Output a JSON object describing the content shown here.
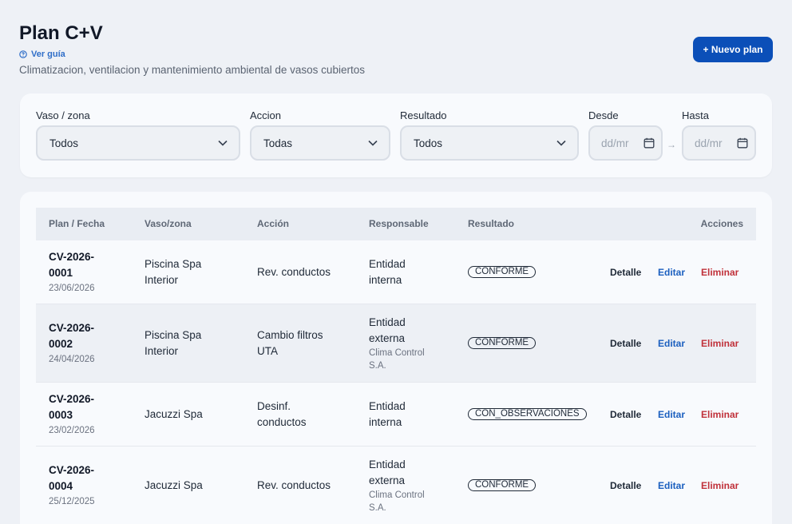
{
  "header": {
    "title": "Plan C+V",
    "guide_label": "Ver guía",
    "subtitle": "Climatizacion, ventilacion y mantenimiento ambiental de vasos cubiertos",
    "new_button": "+ Nuevo plan"
  },
  "filters": {
    "zone": {
      "label": "Vaso / zona",
      "value": "Todos"
    },
    "action": {
      "label": "Accion",
      "value": "Todas"
    },
    "result": {
      "label": "Resultado",
      "value": "Todos"
    },
    "from": {
      "label": "Desde",
      "placeholder": "dd/mr"
    },
    "to": {
      "label": "Hasta",
      "placeholder": "dd/mr"
    },
    "range_separator": "→"
  },
  "table": {
    "columns": [
      "Plan / Fecha",
      "Vaso/zona",
      "Acción",
      "Responsable",
      "Resultado",
      "Acciones"
    ],
    "action_labels": {
      "detail": "Detalle",
      "edit": "Editar",
      "delete": "Eliminar"
    },
    "rows": [
      {
        "code_a": "CV-2026-",
        "code_b": "0001",
        "date": "23/06/2026",
        "zone_a": "Piscina Spa",
        "zone_b": "Interior",
        "action_a": "Rev. conductos",
        "action_b": "",
        "resp_a": "Entidad",
        "resp_b": "interna",
        "resp_sub_a": "",
        "resp_sub_b": "",
        "result": "CONFORME"
      },
      {
        "code_a": "CV-2026-",
        "code_b": "0002",
        "date": "24/04/2026",
        "zone_a": "Piscina Spa",
        "zone_b": "Interior",
        "action_a": "Cambio filtros",
        "action_b": "UTA",
        "resp_a": "Entidad",
        "resp_b": "externa",
        "resp_sub_a": "Clima Control",
        "resp_sub_b": "S.A.",
        "result": "CONFORME"
      },
      {
        "code_a": "CV-2026-",
        "code_b": "0003",
        "date": "23/02/2026",
        "zone_a": "Jacuzzi Spa",
        "zone_b": "",
        "action_a": "Desinf.",
        "action_b": "conductos",
        "resp_a": "Entidad",
        "resp_b": "interna",
        "resp_sub_a": "",
        "resp_sub_b": "",
        "result": "CON_OBSERVACIONES"
      },
      {
        "code_a": "CV-2026-",
        "code_b": "0004",
        "date": "25/12/2025",
        "zone_a": "Jacuzzi Spa",
        "zone_b": "",
        "action_a": "Rev. conductos",
        "action_b": "",
        "resp_a": "Entidad",
        "resp_b": "externa",
        "resp_sub_a": "Clima Control",
        "resp_sub_b": "S.A.",
        "result": "CONFORME"
      }
    ]
  },
  "colors": {
    "primary": "#0b4fb8",
    "link": "#1b5fbf",
    "danger": "#c0313a",
    "background": "#eef1f6"
  }
}
